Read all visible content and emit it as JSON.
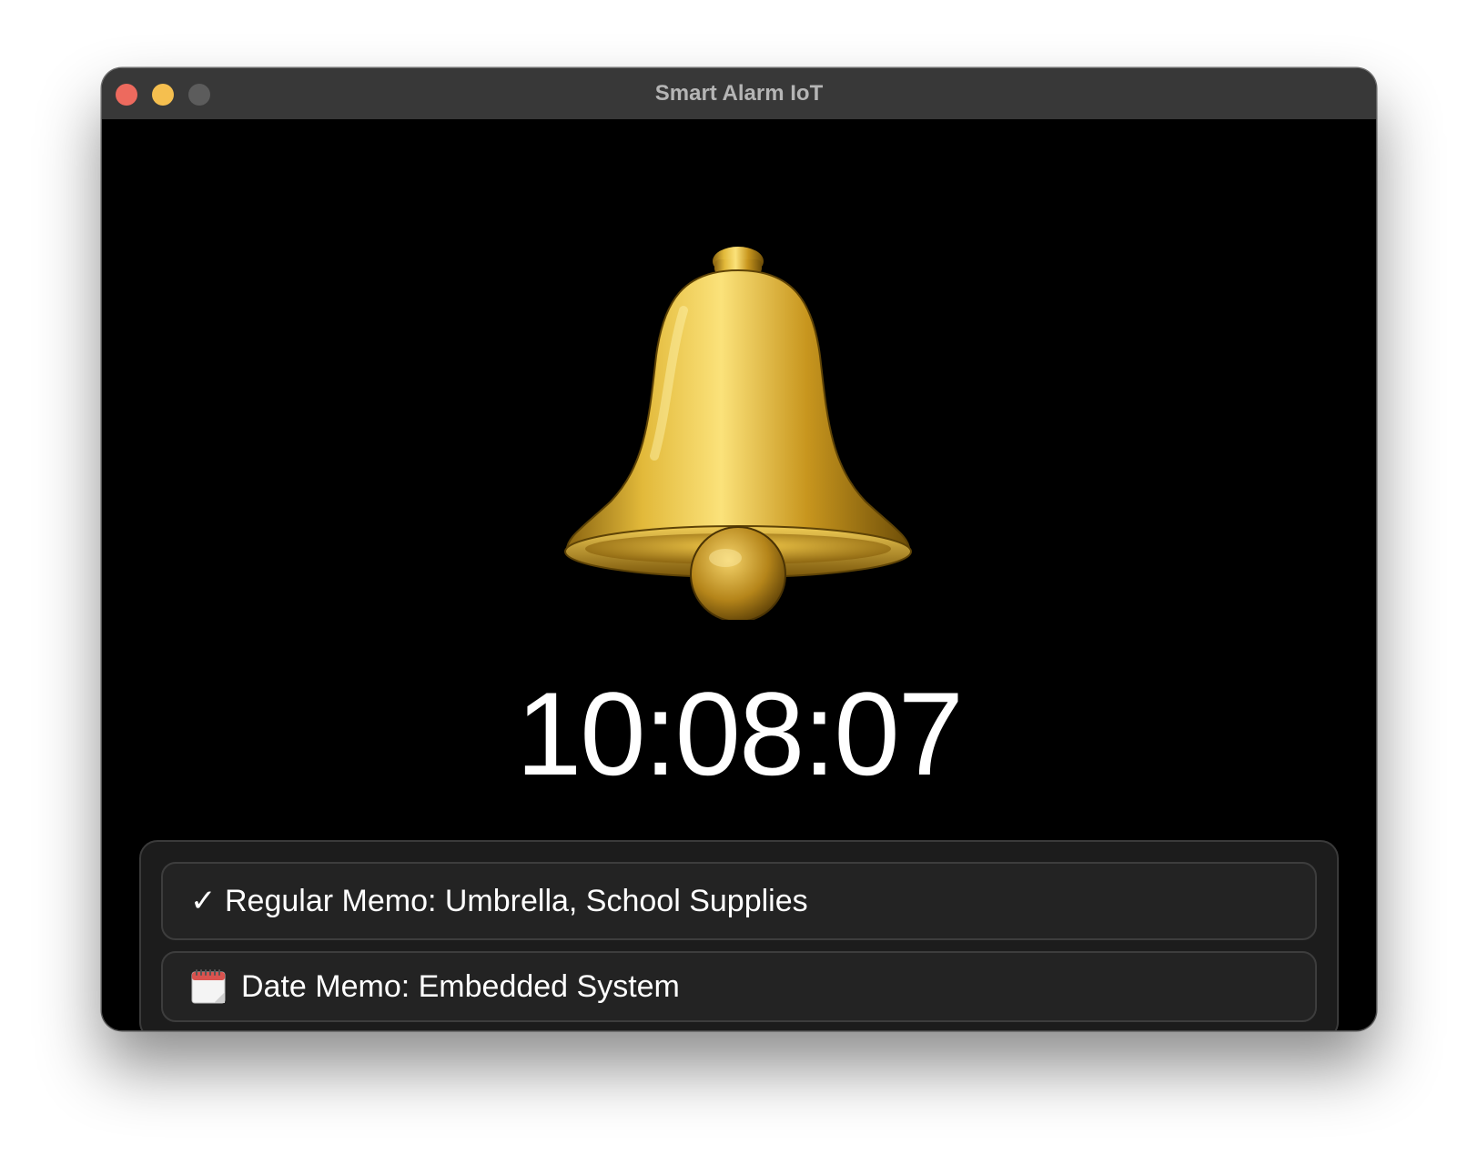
{
  "window": {
    "title": "Smart Alarm IoT"
  },
  "clock": {
    "time": "10:08:07"
  },
  "memos": [
    {
      "icon": "checkmark-icon",
      "glyph": "✓",
      "text": "Regular Memo: Umbrella, School Supplies"
    },
    {
      "icon": "calendar-icon",
      "text": "Date Memo: Embedded System"
    }
  ],
  "colors": {
    "background": "#000000",
    "titlebar": "#383838",
    "panel": "#1c1c1c",
    "row": "#232323",
    "bell_gold": "#d4a520",
    "close": "#ed6a5e",
    "minimize": "#f5bf4f",
    "zoom": "#5c5c5c"
  }
}
